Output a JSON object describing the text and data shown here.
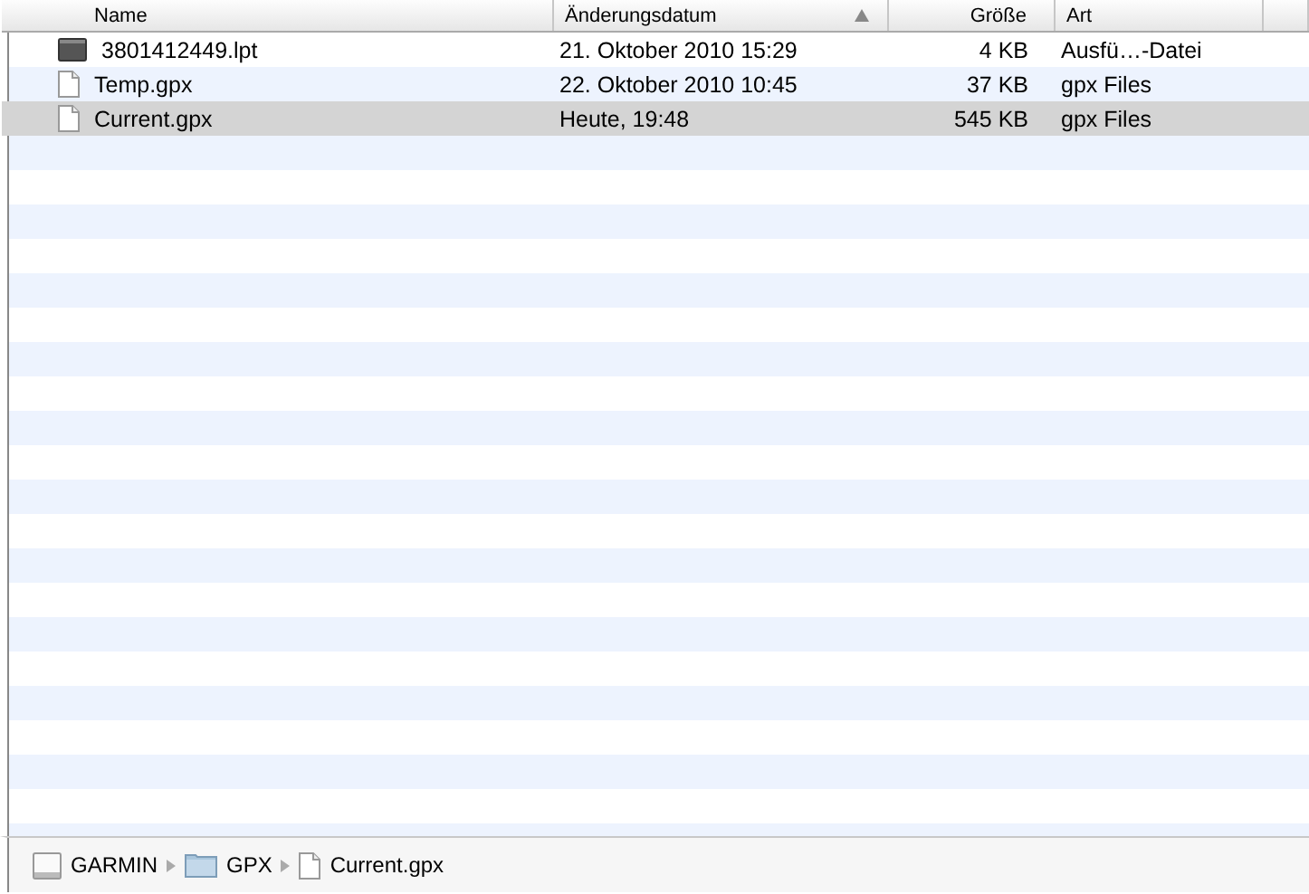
{
  "table": {
    "columns": [
      {
        "label": "Name",
        "sorted": false
      },
      {
        "label": "Änderungsdatum",
        "sorted": true
      },
      {
        "label": "Größe",
        "sorted": false
      },
      {
        "label": "Art",
        "sorted": false
      }
    ],
    "rows": [
      {
        "kind": "executable",
        "name": "3801412449.lpt",
        "date": "21. Oktober 2010 15:29",
        "size": "4 KB",
        "type": "Ausfü…-Datei",
        "selected": false
      },
      {
        "kind": "document",
        "name": "Temp.gpx",
        "date": "22. Oktober 2010 10:45",
        "size": "37 KB",
        "type": "gpx Files",
        "selected": false
      },
      {
        "kind": "document",
        "name": "Current.gpx",
        "date": "Heute, 19:48",
        "size": "545 KB",
        "type": "gpx Files",
        "selected": true
      }
    ]
  },
  "path_bar": [
    {
      "kind": "disk",
      "label": "GARMIN"
    },
    {
      "kind": "folder",
      "label": "GPX"
    },
    {
      "kind": "document",
      "label": "Current.gpx"
    }
  ]
}
